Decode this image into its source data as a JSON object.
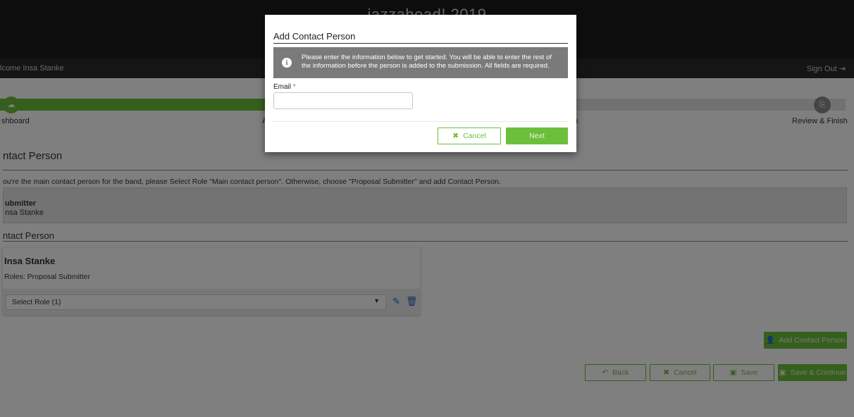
{
  "header": {
    "site_title": "jazzahead! 2019",
    "welcome": "lcome Insa Stanke",
    "sign_out": "Sign Out"
  },
  "progress": {
    "step_1_label": "shboard",
    "step_2_label": "A",
    "step_3_label": "n",
    "last_step_label": "Review & Finish",
    "progress_fraction": 0.32
  },
  "main": {
    "section_title": "ntact Person",
    "instruction": "ou're the main contact person for the band, please Select Role \"Main contact person\". Otherwise, choose \"Proposal Submitter\" and add Contact Person.",
    "submitter_label": "ubmitter",
    "submitter_name": "nsa Stanke",
    "contact_section_title": "ntact Person"
  },
  "contact_card": {
    "name": "Insa Stanke",
    "roles": "Roles: Proposal Submitter",
    "select_role": "Select Role (1)"
  },
  "buttons": {
    "add_contact": "Add Contact Person",
    "back": "Back",
    "cancel": "Cancel",
    "save": "Save",
    "save_continue": "Save & Continue"
  },
  "modal": {
    "title": "Add Contact Person",
    "info_text": "Please enter the information below to get started. You will be able to enter the rest of the information before the person is added to the submission. All fields are required.",
    "email_label": "Email",
    "required_marker": "*",
    "email_value": "",
    "cancel": "Cancel",
    "next": "Next"
  },
  "colors": {
    "accent_green": "#6cbf3b",
    "info_banner": "#7a7a7a",
    "icon_blue": "#1e5fbf",
    "header_dark": "#1c1c1c"
  }
}
